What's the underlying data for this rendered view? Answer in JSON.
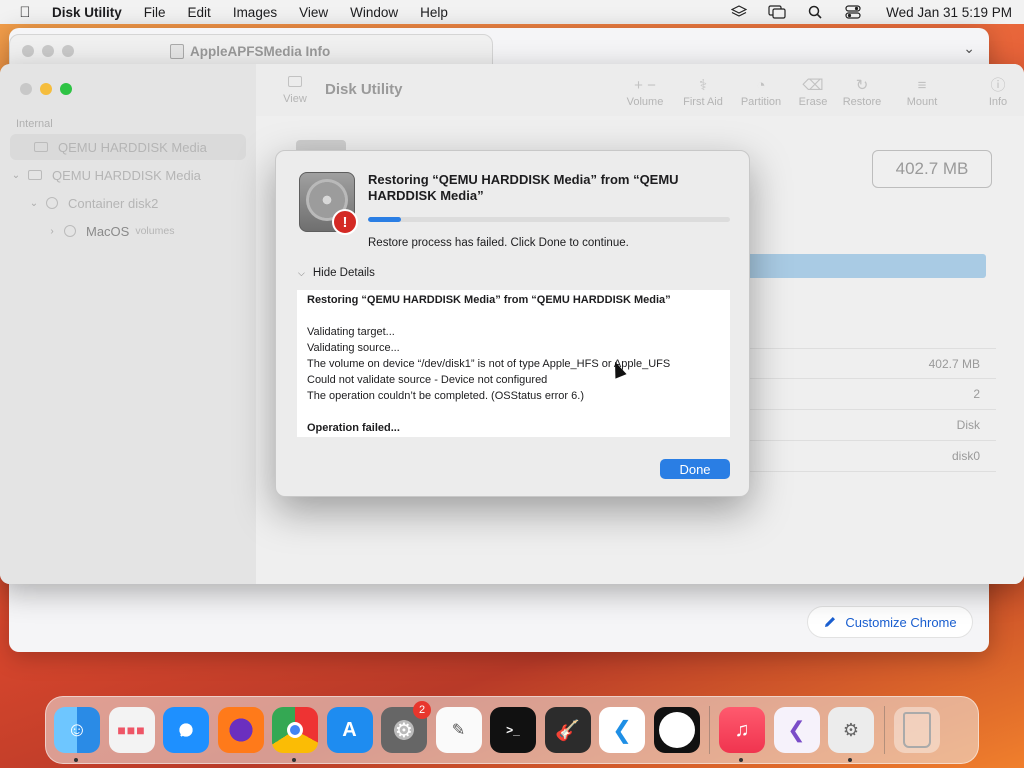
{
  "menubar": {
    "app_name": "Disk Utility",
    "items": [
      "File",
      "Edit",
      "Images",
      "View",
      "Window",
      "Help"
    ],
    "clock": "Wed Jan 31  5:19 PM",
    "status_icons": [
      "layers-icon",
      "screen-mirroring-icon",
      "search-icon",
      "control-center-icon"
    ]
  },
  "chrome_window": {
    "tab_title": "AppleAPFSMedia Info",
    "customize_label": "Customize Chrome"
  },
  "disk_utility": {
    "title": "Disk Utility",
    "view_label": "View",
    "toolbar": [
      {
        "label": "Volume",
        "icon": "plus-minus-icon"
      },
      {
        "label": "First Aid",
        "icon": "first-aid-icon"
      },
      {
        "label": "Partition",
        "icon": "partition-icon"
      },
      {
        "label": "Erase",
        "icon": "erase-icon"
      },
      {
        "label": "Restore",
        "icon": "restore-icon"
      },
      {
        "label": "Mount",
        "icon": "mount-icon"
      },
      {
        "label": "Info",
        "icon": "info-icon"
      }
    ],
    "sidebar": {
      "section": "Internal",
      "items": [
        {
          "label": "QEMU HARDDISK Media"
        },
        {
          "label": "QEMU HARDDISK Media"
        },
        {
          "label": "Container disk2"
        },
        {
          "label": "MacOS",
          "sublabel": "volumes"
        }
      ]
    },
    "size_display": "402.7 MB",
    "info_values": [
      "402.7 MB",
      "2",
      "Disk",
      "disk0"
    ]
  },
  "dialog": {
    "title": "Restoring “QEMU HARDDISK Media” from “QEMU HARDDISK Media”",
    "progress": 0.09,
    "status": "Restore process has failed. Click Done to continue.",
    "details_toggle": "Hide Details",
    "details": [
      {
        "text": "Restoring “QEMU HARDDISK Media” from “QEMU HARDDISK Media”",
        "bold": true
      },
      {
        "text": "",
        "bold": false
      },
      {
        "text": "Validating target...",
        "bold": false
      },
      {
        "text": "Validating source...",
        "bold": false
      },
      {
        "text": "The volume on device “/dev/disk1” is not of type Apple_HFS or Apple_UFS",
        "bold": false
      },
      {
        "text": "Could not validate source - Device not configured",
        "bold": false
      },
      {
        "text": "The operation couldn’t be completed. (OSStatus error 6.)",
        "bold": false
      },
      {
        "text": "",
        "bold": false
      },
      {
        "text": "Operation failed...",
        "bold": true
      }
    ],
    "done_label": "Done"
  },
  "dock": {
    "apps": [
      {
        "name": "Finder",
        "running": true
      },
      {
        "name": "Launchpad",
        "running": false
      },
      {
        "name": "Safari",
        "running": false
      },
      {
        "name": "Firefox",
        "running": false
      },
      {
        "name": "Chrome",
        "running": true
      },
      {
        "name": "App Store",
        "running": false
      },
      {
        "name": "System Settings",
        "running": false,
        "badge": "2"
      },
      {
        "name": "TextEdit",
        "running": false
      },
      {
        "name": "Terminal",
        "running": false
      },
      {
        "name": "GarageBand",
        "running": false
      },
      {
        "name": "Visual Studio Code",
        "running": false
      },
      {
        "name": "Clock",
        "running": false
      },
      {
        "name": "Music",
        "running": true
      },
      {
        "name": "Visual Studio",
        "running": false
      },
      {
        "name": "Disk Utility",
        "running": true
      },
      {
        "name": "Trash",
        "running": false
      }
    ]
  },
  "colors": {
    "accent": "#2a7ee4",
    "alert": "#d42a25",
    "usage_bar": "#a9cbe4"
  }
}
